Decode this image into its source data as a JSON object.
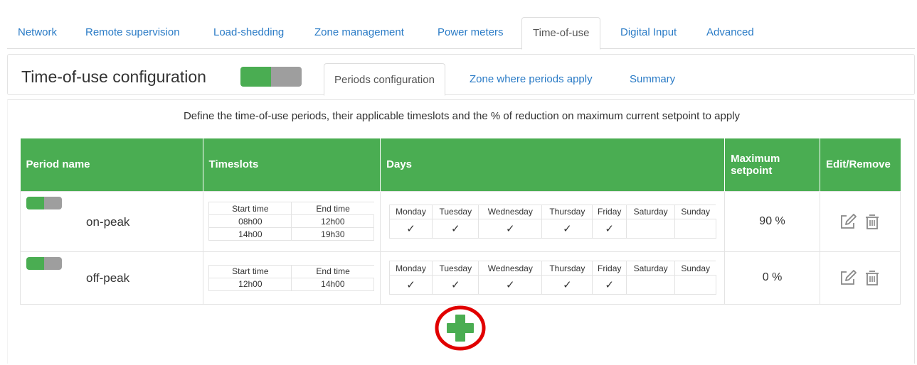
{
  "top_tabs": [
    {
      "label": "Network"
    },
    {
      "label": "Remote supervision"
    },
    {
      "label": "Load-shedding"
    },
    {
      "label": "Zone management"
    },
    {
      "label": "Power meters"
    },
    {
      "label": "Time-of-use",
      "active": true
    },
    {
      "label": "Digital Input"
    },
    {
      "label": "Advanced"
    }
  ],
  "header": {
    "title": "Time-of-use configuration",
    "enabled": true,
    "sub_tabs": [
      {
        "label": "Periods configuration",
        "active": true
      },
      {
        "label": "Zone where periods apply"
      },
      {
        "label": "Summary"
      }
    ]
  },
  "description": "Define the time-of-use periods, their applicable timeslots and the % of reduction on maximum current setpoint to apply",
  "table": {
    "headers": {
      "period_name": "Period name",
      "timeslots": "Timeslots",
      "days": "Days",
      "maximum_setpoint": "Maximum setpoint",
      "edit_remove": "Edit/Remove"
    },
    "timeslot_headers": {
      "start": "Start time",
      "end": "End time"
    },
    "day_names": [
      "Monday",
      "Tuesday",
      "Wednesday",
      "Thursday",
      "Friday",
      "Saturday",
      "Sunday"
    ],
    "check_mark": "✓",
    "rows": [
      {
        "name": "on-peak",
        "enabled": true,
        "timeslots": [
          {
            "start": "08h00",
            "end": "12h00"
          },
          {
            "start": "14h00",
            "end": "19h30"
          }
        ],
        "days": [
          true,
          true,
          true,
          true,
          true,
          false,
          false
        ],
        "max_setpoint": "90 %"
      },
      {
        "name": "off-peak",
        "enabled": true,
        "timeslots": [
          {
            "start": "12h00",
            "end": "14h00"
          }
        ],
        "days": [
          true,
          true,
          true,
          true,
          true,
          false,
          false
        ],
        "max_setpoint": "0 %"
      }
    ]
  },
  "icons": {
    "edit": "pencil-square-icon",
    "remove": "trash-icon",
    "add": "plus-icon"
  },
  "colors": {
    "accent_green": "#4aad52",
    "toggle_off": "#9e9e9e",
    "link_blue": "#2a7bc6",
    "highlight_circle": "#e10000"
  }
}
